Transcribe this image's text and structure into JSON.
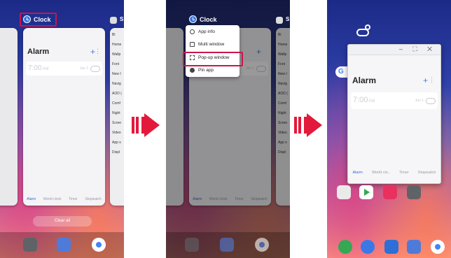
{
  "recents": {
    "app_name": "Clock",
    "clear_all": "Clear all",
    "settings_partial": "S",
    "settings_items": [
      "Bi",
      "Home",
      "Wallp",
      "Font",
      "New I",
      "Navig",
      "AOD (",
      "Comf",
      "Night",
      "Scree",
      "Video",
      "App s",
      "Displ"
    ]
  },
  "clock_app": {
    "screen_title": "Alarm",
    "add_icon": "+",
    "more_icon": "⋮",
    "alarm_time": "7:00",
    "alarm_ampm": "AM",
    "alarm_day": "Jan 1",
    "tabs": [
      "Alarm",
      "World clock",
      "Timer",
      "Stopwatch"
    ]
  },
  "popup_tabs": [
    "Alarm",
    "World clo..",
    "Timer",
    "Stopwatch"
  ],
  "menu": {
    "items": [
      {
        "label": "App info",
        "icon": "info-icon"
      },
      {
        "label": "Multi window",
        "icon": "multi-window-icon"
      },
      {
        "label": "Pop-up window",
        "icon": "popup-window-icon"
      },
      {
        "label": "Pin app",
        "icon": "pin-icon"
      }
    ]
  },
  "popup_window": {
    "controls": "– ⛶ ✕"
  },
  "colors": {
    "highlight": "#c8164b",
    "arrow": "#e3193b",
    "accent": "#3367d6"
  }
}
